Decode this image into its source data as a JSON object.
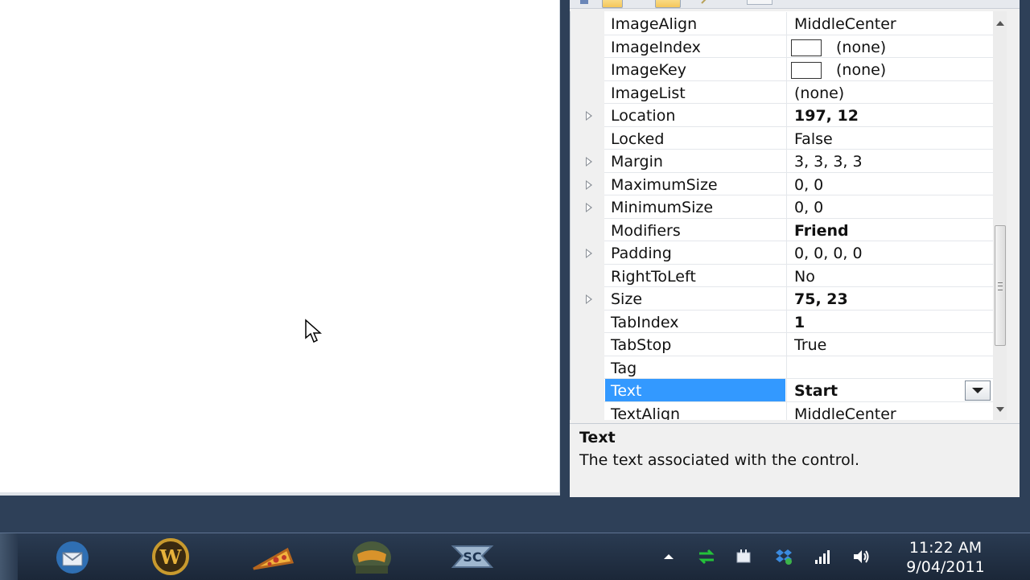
{
  "properties": {
    "rows": [
      {
        "name": "ImageAlign",
        "value": "MiddleCenter",
        "expandable": false,
        "bold": false,
        "swatch": false
      },
      {
        "name": "ImageIndex",
        "value": "(none)",
        "expandable": false,
        "bold": false,
        "swatch": true
      },
      {
        "name": "ImageKey",
        "value": "(none)",
        "expandable": false,
        "bold": false,
        "swatch": true
      },
      {
        "name": "ImageList",
        "value": "(none)",
        "expandable": false,
        "bold": false,
        "swatch": false
      },
      {
        "name": "Location",
        "value": "197, 12",
        "expandable": true,
        "bold": true,
        "swatch": false
      },
      {
        "name": "Locked",
        "value": "False",
        "expandable": false,
        "bold": false,
        "swatch": false
      },
      {
        "name": "Margin",
        "value": "3, 3, 3, 3",
        "expandable": true,
        "bold": false,
        "swatch": false
      },
      {
        "name": "MaximumSize",
        "value": "0, 0",
        "expandable": true,
        "bold": false,
        "swatch": false
      },
      {
        "name": "MinimumSize",
        "value": "0, 0",
        "expandable": true,
        "bold": false,
        "swatch": false
      },
      {
        "name": "Modifiers",
        "value": "Friend",
        "expandable": false,
        "bold": true,
        "swatch": false
      },
      {
        "name": "Padding",
        "value": "0, 0, 0, 0",
        "expandable": true,
        "bold": false,
        "swatch": false
      },
      {
        "name": "RightToLeft",
        "value": "No",
        "expandable": false,
        "bold": false,
        "swatch": false
      },
      {
        "name": "Size",
        "value": "75, 23",
        "expandable": true,
        "bold": true,
        "swatch": false
      },
      {
        "name": "TabIndex",
        "value": "1",
        "expandable": false,
        "bold": true,
        "swatch": false
      },
      {
        "name": "TabStop",
        "value": "True",
        "expandable": false,
        "bold": false,
        "swatch": false
      },
      {
        "name": "Tag",
        "value": "",
        "expandable": false,
        "bold": false,
        "swatch": false
      },
      {
        "name": "Text",
        "value": "Start",
        "expandable": false,
        "bold": true,
        "swatch": false,
        "selected": true
      },
      {
        "name": "TextAlign",
        "value": "MiddleCenter",
        "expandable": false,
        "bold": false,
        "swatch": false
      }
    ]
  },
  "description": {
    "title": "Text",
    "text": "The text associated with the control."
  },
  "colors": {
    "selection": "#3399ff",
    "taskbar": "#1b2738"
  },
  "taskbar": {
    "apps": [
      "thunderbird-icon",
      "world-of-warcraft-icon",
      "pizza-icon",
      "halo-icon",
      "starcraft-icon"
    ],
    "tray": [
      "show-hidden-icons-icon",
      "network-activity-icon",
      "power-icon",
      "dropbox-icon",
      "signal-icon",
      "volume-icon"
    ],
    "time": "11:22 AM",
    "date": "9/04/2011"
  }
}
